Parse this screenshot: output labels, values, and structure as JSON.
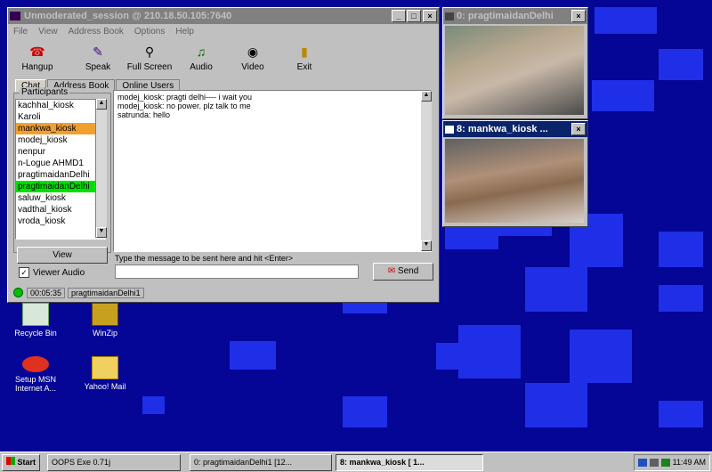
{
  "main_window": {
    "title": "Unmoderated_session @ 210.18.50.105:7640",
    "title_buttons": [
      "_",
      "□",
      "×"
    ],
    "menu": [
      "File",
      "View",
      "Address Book",
      "Options",
      "Help"
    ],
    "toolbar": [
      {
        "label": "Hangup",
        "icon": "hangup-icon"
      },
      {
        "label": "Speak",
        "icon": "speak-icon"
      },
      {
        "label": "Full Screen",
        "icon": "fullscreen-icon"
      },
      {
        "label": "Audio",
        "icon": "audio-icon"
      },
      {
        "label": "Video",
        "icon": "video-icon"
      },
      {
        "label": "Exit",
        "icon": "exit-icon"
      }
    ],
    "tabs": [
      "Chat",
      "Address Book",
      "Online Users"
    ],
    "participants_label": "Participants",
    "participants": [
      "kachhal_kiosk",
      "Karoli",
      "mankwa_kiosk",
      "modej_kiosk",
      "nenpur",
      "n-Logue AHMD1",
      "pragtimaidanDelhi",
      "pragtimaidanDelhi",
      "saluw_kiosk",
      "vadthal_kiosk",
      "vroda_kiosk"
    ],
    "highlight_colors": {
      "orange": "#f0a030",
      "green": "#00e000"
    },
    "chat_lines": [
      "modej_kiosk: pragti delhi---- i wait you",
      "modej_kiosk: no power. plz talk to me",
      "satrunda: hello"
    ],
    "view_button": "View",
    "viewer_audio_label": "Viewer Audio",
    "message_hint": "Type the message to be sent here and hit <Enter>",
    "message_value": "",
    "send_button": "Send",
    "status_time": "00:05:35",
    "status_user": "pragtimaidanDelhi1"
  },
  "video1": {
    "title": "0: pragtimaidanDelhi"
  },
  "video2": {
    "title": "8: mankwa_kiosk ..."
  },
  "desktop_icons": [
    {
      "label": "Recycle Bin",
      "icon": "recycle-bin-icon"
    },
    {
      "label": "WinZip",
      "icon": "winzip-icon"
    },
    {
      "label": "Setup MSN Internet A...",
      "icon": "msn-icon"
    },
    {
      "label": "Yahoo! Mail",
      "icon": "yahoo-mail-icon"
    }
  ],
  "taskbar": {
    "start": "Start",
    "items": [
      "OOPS Exe 0.71j",
      "0: pragtimaidanDelhi1 [12...",
      "8: mankwa_kiosk [ 1..."
    ],
    "clock": "11:49 AM"
  }
}
